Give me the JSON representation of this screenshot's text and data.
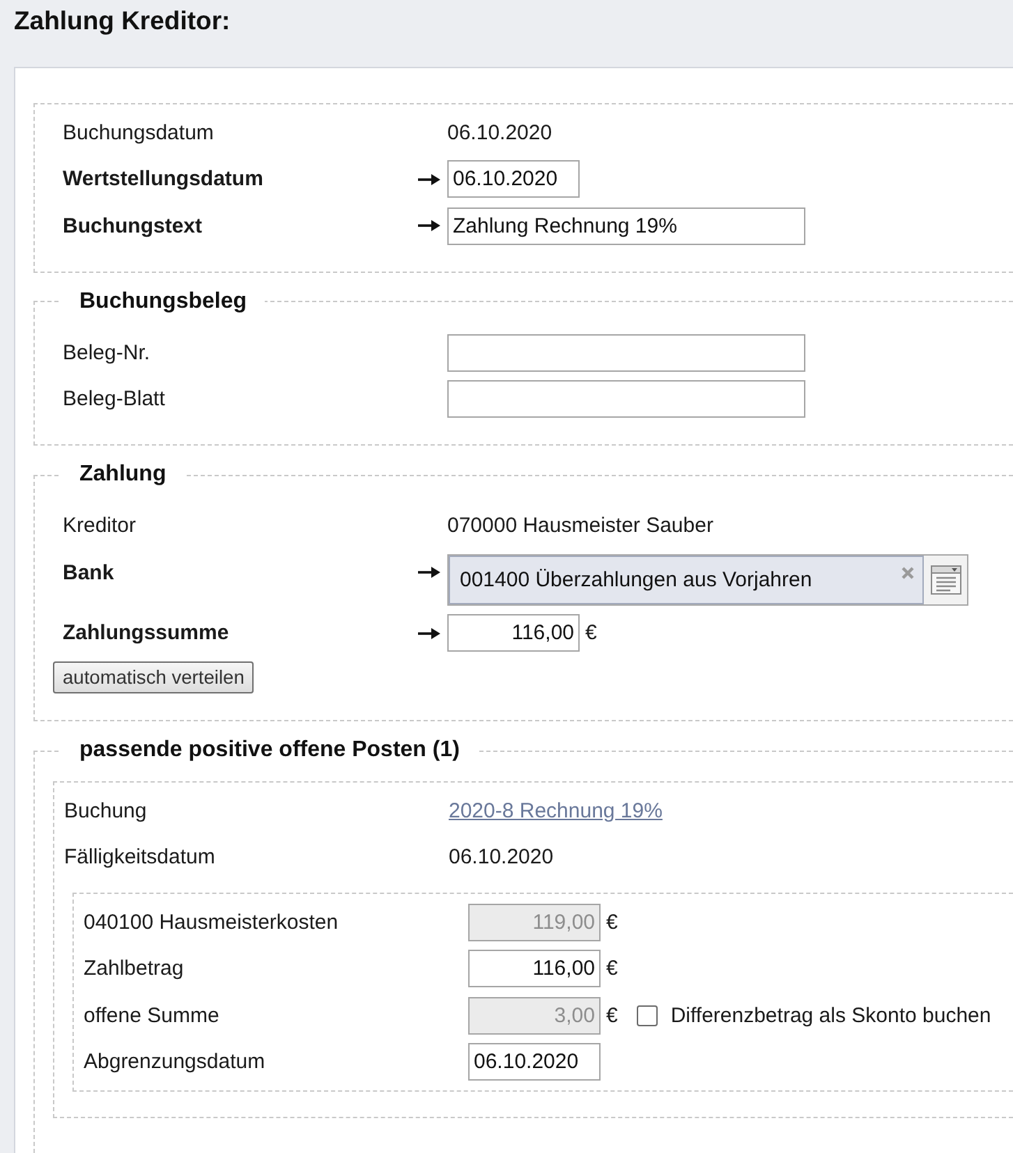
{
  "title": "Zahlung Kreditor:",
  "sections": [
    {
      "kind": "form",
      "rows": [
        {
          "kind": "display",
          "label": "Buchungsdatum",
          "required": false,
          "value": "06.10.2020"
        },
        {
          "kind": "date",
          "label": "Wertstellungsdatum",
          "required": true,
          "value": "06.10.2020"
        },
        {
          "kind": "text",
          "label": "Buchungstext",
          "required": true,
          "value": "Zahlung Rechnung 19%"
        }
      ]
    },
    {
      "kind": "form",
      "legend": "Buchungsbeleg",
      "rows": [
        {
          "kind": "text",
          "label": "Beleg-Nr.",
          "required": false
        },
        {
          "kind": "text",
          "label": "Beleg-Blatt",
          "required": false
        }
      ]
    },
    {
      "kind": "form",
      "legend": "Zahlung",
      "rows": [
        {
          "kind": "display",
          "label": "Kreditor",
          "required": false,
          "value": "070000 Hausmeister Sauber"
        },
        {
          "kind": "select",
          "label": "Bank",
          "required": true,
          "value": "001400 Überzahlungen aus Vorjahren"
        },
        {
          "kind": "amount",
          "label": "Zahlungssumme",
          "required": true,
          "value": "116,00",
          "unit": "€"
        }
      ],
      "button": "automatisch verteilen"
    },
    {
      "kind": "open-items",
      "legend": "passende positive offene Posten (1)",
      "items": [
        {
          "rows": [
            {
              "kind": "link",
              "label": "Buchung",
              "value": "2020-8 Rechnung 19%"
            },
            {
              "kind": "display",
              "label": "Fälligkeitsdatum",
              "value": "06.10.2020"
            }
          ],
          "accounts": [
            {
              "rows": [
                {
                  "kind": "amount",
                  "label": "040100 Hausmeisterkosten",
                  "value": "119,00",
                  "unit": "€",
                  "disabled": true
                },
                {
                  "kind": "amount",
                  "label": "Zahlbetrag",
                  "value": "116,00",
                  "unit": "€",
                  "disabled": false
                },
                {
                  "kind": "amount",
                  "label": "offene Summe",
                  "value": "3,00",
                  "unit": "€",
                  "disabled": true,
                  "checkbox": {
                    "label": "Differenzbetrag als Skonto buchen",
                    "checked": false
                  }
                },
                {
                  "kind": "date",
                  "label": "Abgrenzungsdatum",
                  "value": "06.10.2020",
                  "disabled": false
                }
              ]
            }
          ]
        }
      ]
    }
  ]
}
